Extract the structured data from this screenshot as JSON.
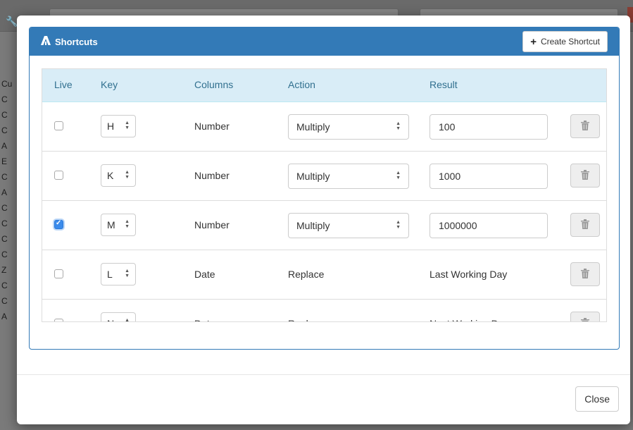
{
  "background": {
    "left_letters": [
      "Cu",
      "C",
      "C",
      "C",
      "A",
      "E",
      "C",
      "A",
      "C",
      "C",
      "C",
      "C",
      "Z",
      "C",
      "C",
      "A"
    ],
    "right_letters": [
      "",
      "",
      "",
      "",
      "",
      "",
      "",
      "",
      "",
      "",
      "",
      "",
      "",
      "",
      "",
      ""
    ]
  },
  "modal": {
    "panel_title": "Shortcuts",
    "create_button_label": "Create Shortcut",
    "close_button_label": "Close",
    "columns": {
      "live": "Live",
      "key": "Key",
      "columns": "Columns",
      "action": "Action",
      "result": "Result"
    },
    "rows": [
      {
        "live": false,
        "key": "H",
        "column": "Number",
        "action": "Multiply",
        "action_editable": true,
        "result": "100",
        "result_editable": true
      },
      {
        "live": false,
        "key": "K",
        "column": "Number",
        "action": "Multiply",
        "action_editable": true,
        "result": "1000",
        "result_editable": true
      },
      {
        "live": true,
        "key": "M",
        "column": "Number",
        "action": "Multiply",
        "action_editable": true,
        "result": "1000000",
        "result_editable": true
      },
      {
        "live": false,
        "key": "L",
        "column": "Date",
        "action": "Replace",
        "action_editable": false,
        "result": "Last Working Day",
        "result_editable": false
      },
      {
        "live": false,
        "key": "N",
        "column": "Date",
        "action": "Replace",
        "action_editable": false,
        "result": "Next Working Day",
        "result_editable": false
      }
    ]
  },
  "colors": {
    "primary": "#337ab7",
    "header_bg": "#d9edf7",
    "header_text": "#31708f",
    "checked": "#3b8beb"
  },
  "icons": {
    "logo": "brand-a-icon",
    "add": "plus-icon",
    "delete": "trash-icon",
    "sort": "updown-arrows-icon"
  }
}
